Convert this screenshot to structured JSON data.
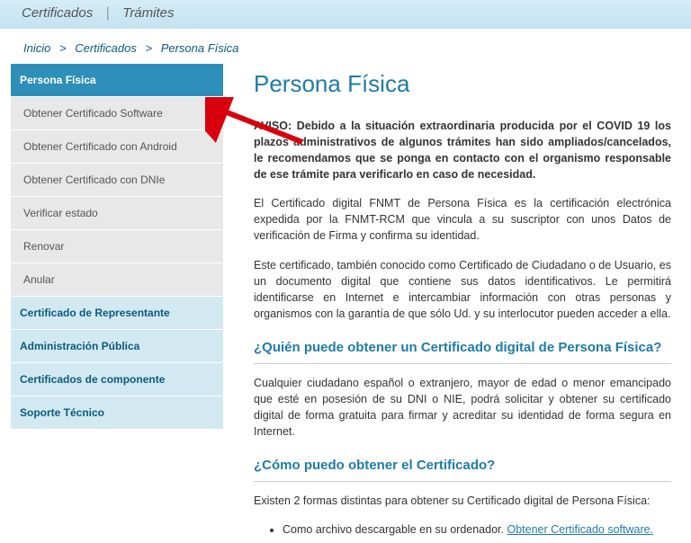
{
  "topnav": {
    "certificados": "Certificados",
    "tramites": "Trámites"
  },
  "breadcrumb": {
    "inicio": "Inicio",
    "cert": "Certificados",
    "pf": "Persona Física"
  },
  "sidebar": {
    "active": "Persona Física",
    "sub": {
      "soft": "Obtener Certificado Software",
      "android": "Obtener Certificado con Android",
      "dnie": "Obtener Certificado con DNIe",
      "verify": "Verificar estado",
      "renew": "Renovar",
      "anular": "Anular"
    },
    "main": {
      "rep": "Certificado de Representante",
      "admin": "Administración Pública",
      "comp": "Certificados de componente",
      "sup": "Soporte Técnico"
    }
  },
  "content": {
    "title": "Persona Física",
    "notice": "AVISO: Debido a la situación extraordinaria producida por el COVID 19 los plazos administrativos de algunos trámites han sido ampliados/cancelados, le recomendamos que se ponga en contacto con el organismo responsable de ese trámite para verificarlo en caso de necesidad.",
    "p1": "El Certificado digital FNMT de Persona Física es la certificación electrónica expedida por la FNMT-RCM que vincula a su suscriptor con unos Datos de verificación de Firma y confirma su identidad.",
    "p2": "Este certificado, también conocido como Certificado de Ciudadano o de Usuario, es un documento digital que contiene sus datos identificativos. Le permitirá identificarse en Internet e intercambiar información con otras personas y organismos con la garantía de que sólo Ud. y su interlocutor pueden acceder a ella.",
    "h_who": "¿Quién puede obtener un Certificado digital de Persona Física?",
    "p_who": "Cualquier ciudadano español o extranjero, mayor de edad o menor emancipado que esté en posesión de su DNI o NIE, podrá solicitar y obtener su certificado digital de forma gratuita para firmar y acreditar su identidad de forma segura en Internet.",
    "h_how": "¿Cómo puedo obtener el Certificado?",
    "p_how": "Existen 2 formas distintas para obtener su Certificado digital de Persona Física:",
    "li1_text": "Como archivo descargable en su ordenador. ",
    "li1_link": "Obtener Certificado software."
  }
}
